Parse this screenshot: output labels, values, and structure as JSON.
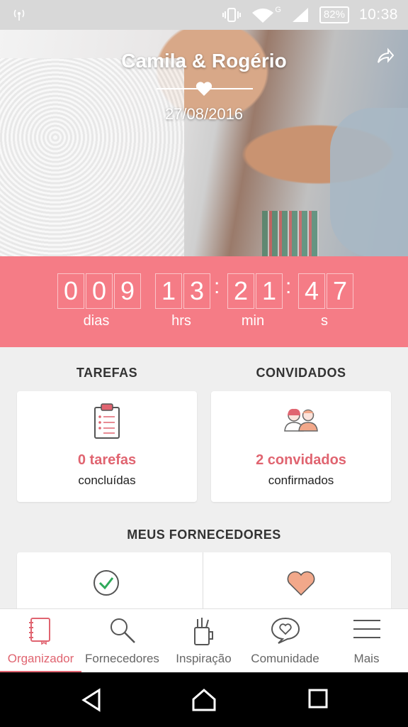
{
  "status_bar": {
    "battery": "82%",
    "time": "10:38",
    "signal_label": "G"
  },
  "hero": {
    "couple_name": "Camila & Rogério",
    "date": "27/08/2016"
  },
  "countdown": {
    "days_digits": [
      "0",
      "0",
      "9"
    ],
    "hours_digits": [
      "1",
      "3"
    ],
    "minutes_digits": [
      "2",
      "1"
    ],
    "seconds_digits": [
      "4",
      "7"
    ],
    "separator": ":",
    "labels": {
      "days": "dias",
      "hours": "hrs",
      "minutes": "min",
      "seconds": "s"
    }
  },
  "tasks": {
    "title": "TAREFAS",
    "count": "0 tarefas",
    "subtitle": "concluídas"
  },
  "guests": {
    "title": "CONVIDADOS",
    "count": "2 convidados",
    "subtitle": "confirmados"
  },
  "vendors": {
    "title": "MEUS FORNECEDORES"
  },
  "bottom_nav": {
    "items": [
      {
        "label": "Organizador",
        "icon": "notebook-icon",
        "active": true
      },
      {
        "label": "Fornecedores",
        "icon": "search-icon",
        "active": false
      },
      {
        "label": "Inspiração",
        "icon": "pencil-cup-icon",
        "active": false
      },
      {
        "label": "Comunidade",
        "icon": "chat-heart-icon",
        "active": false
      },
      {
        "label": "Mais",
        "icon": "menu-icon",
        "active": false
      }
    ]
  },
  "colors": {
    "accent": "#f57c86",
    "accent_text": "#e06470"
  }
}
